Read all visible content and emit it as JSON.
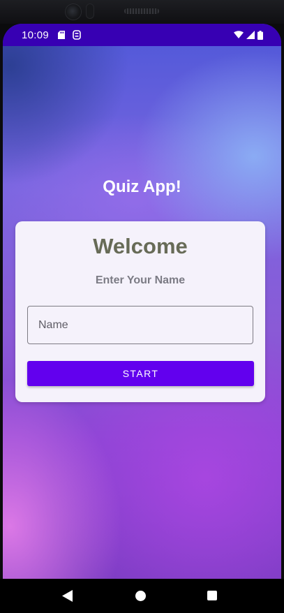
{
  "status_bar": {
    "time": "10:09",
    "left_icons": [
      "sd-card-icon",
      "storage-icon"
    ],
    "right_icons": [
      "wifi-icon",
      "cellular-signal-icon",
      "battery-icon"
    ],
    "background_color": "#3700b3"
  },
  "app": {
    "title": "Quiz App!"
  },
  "card": {
    "heading": "Welcome",
    "prompt": "Enter Your Name",
    "name_input": {
      "value": "",
      "placeholder": "Name"
    },
    "start_button_label": "START"
  },
  "navigation_bar": {
    "buttons": [
      "back-icon",
      "home-icon",
      "recents-icon"
    ]
  },
  "colors": {
    "accent": "#6200ee",
    "heading_text": "#676b57",
    "card_background": "#f5f2fb"
  }
}
